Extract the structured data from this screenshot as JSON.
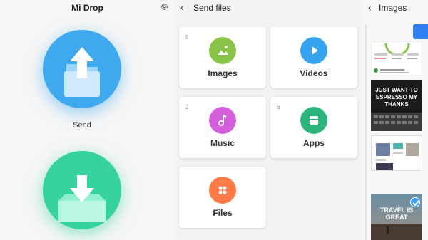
{
  "panel_main": {
    "title": "Mi Drop",
    "send_label": "Send"
  },
  "panel_send": {
    "title": "Send files",
    "cards": [
      {
        "label": "Images",
        "count": "5",
        "color": "#8bc34a",
        "icon": "image-icon"
      },
      {
        "label": "Videos",
        "count": "",
        "color": "#35a3ee",
        "icon": "play-icon"
      },
      {
        "label": "Music",
        "count": "2",
        "color": "#d45fdc",
        "icon": "music-note-icon"
      },
      {
        "label": "Apps",
        "count": "6",
        "color": "#2db47d",
        "icon": "app-icon"
      },
      {
        "label": "Files",
        "count": "",
        "color": "#ff7a45",
        "icon": "files-icon"
      }
    ]
  },
  "panel_images": {
    "title": "Images",
    "thumbs": [
      {
        "text": "JUST WANT TO ESPRESSO MY THANKS"
      },
      {
        "text": "TRAVEL IS GREAT"
      }
    ]
  },
  "colors": {
    "send": "#3fa9f0",
    "receive": "#36d39c",
    "accent": "#2f7ff0"
  }
}
